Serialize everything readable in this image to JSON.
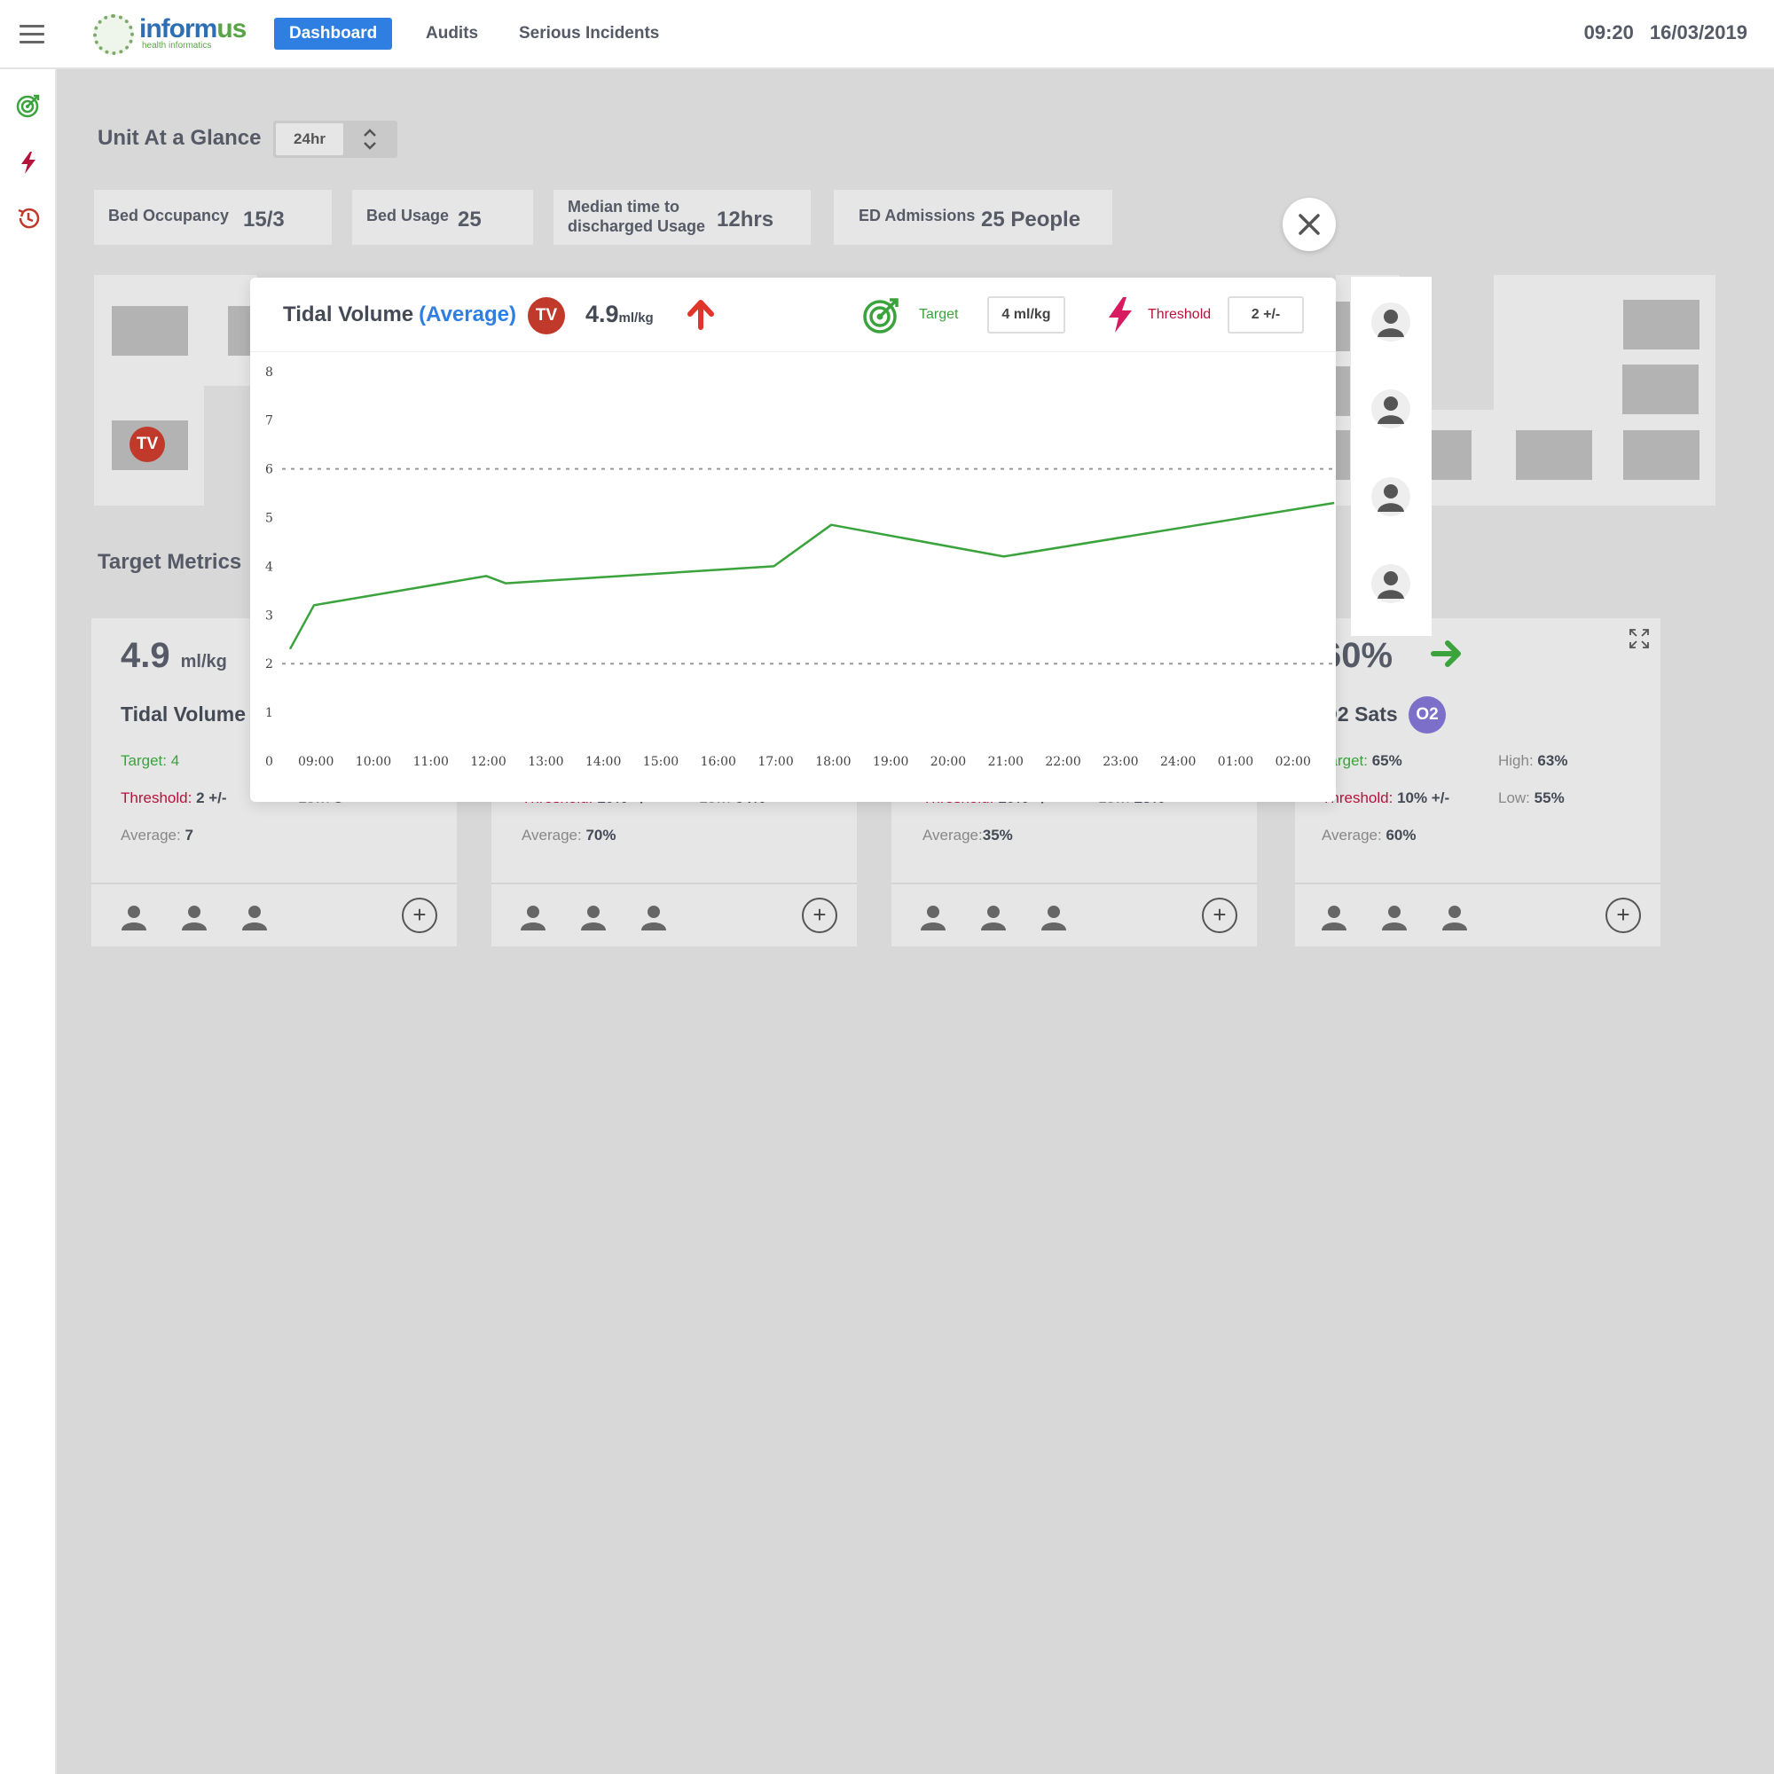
{
  "header": {
    "logo": {
      "brand_a": "inform",
      "brand_b": "us",
      "tagline": "health informatics"
    },
    "nav": [
      {
        "label": "Dashboard",
        "active": true
      },
      {
        "label": "Audits",
        "active": false
      },
      {
        "label": "Serious Incidents",
        "active": false
      }
    ],
    "time": "09:20",
    "date": "16/03/2019"
  },
  "sidebar": {
    "icons": [
      "target-icon",
      "bolt-icon",
      "history-icon"
    ]
  },
  "glance": {
    "title": "Unit At a Glance",
    "period": "24hr",
    "stats": [
      {
        "label": "Bed Occupancy",
        "value": "15/3"
      },
      {
        "label": "Bed Usage",
        "value": "25"
      },
      {
        "label_line1": "Median time to",
        "label_line2": "discharged Usage",
        "value": "12hrs"
      },
      {
        "label": "ED Admissions",
        "value": "25 People"
      }
    ]
  },
  "map": {
    "chip": "TV"
  },
  "target_metrics": {
    "title": "Target Metrics",
    "cards": [
      {
        "value": "4.9",
        "unit": "ml/kg",
        "name": "Tidal Volume",
        "target_label": "Target:",
        "target": "4",
        "threshold_label": "Threshold:",
        "threshold": "2 +/-",
        "low_label": "Low:",
        "low": "3",
        "average_label": "Average:",
        "average": "7"
      },
      {
        "threshold_label": "Threshold:",
        "threshold": "10% +/-",
        "low_label": "Low:",
        "low": "64%",
        "average_label": "Average:",
        "average": "70%"
      },
      {
        "threshold_label": "Threshold:",
        "threshold": "10% +/-",
        "low_label": "Low:",
        "low": "25%",
        "average_label": "Average:",
        "average": "35%"
      },
      {
        "value": "60%",
        "name": "O2 Sats",
        "chip": "O2",
        "target_label": "Target:",
        "target": "65%",
        "high_label": "High:",
        "high": "63%",
        "threshold_label": "Threshold:",
        "threshold": "10% +/-",
        "low_label": "Low:",
        "low": "55%",
        "average_label": "Average:",
        "average": "60%"
      }
    ],
    "add_label": "+"
  },
  "modal": {
    "title": "Tidal Volume",
    "subtitle": "(Average)",
    "chip": "TV",
    "value": "4.9",
    "unit": "ml/kg",
    "target_label": "Target",
    "target_value": "4 ml/kg",
    "threshold_label": "Threshold",
    "threshold_value": "2 +/-"
  },
  "colors": {
    "accent": "#2f7fe3",
    "line": "#3aa33c",
    "target": "#3aa33c",
    "threshold": "#b5123c",
    "tv_chip": "#c0392b",
    "o2_chip": "#7b6fc9"
  },
  "chart_data": {
    "type": "line",
    "title": "",
    "xlabel": "",
    "ylabel": "",
    "x": [
      "09:00",
      "10:00",
      "11:00",
      "12:00",
      "13:00",
      "14:00",
      "15:00",
      "16:00",
      "17:00",
      "18:00",
      "19:00",
      "20:00",
      "21:00",
      "22:00",
      "23:00",
      "24:00",
      "01:00",
      "02:00"
    ],
    "ylim": [
      0,
      8
    ],
    "yticks": [
      0,
      1,
      2,
      3,
      4,
      5,
      6,
      7,
      8
    ],
    "series": [
      {
        "points": [
          [
            "08:35",
            2.3
          ],
          [
            "09:00",
            3.2
          ],
          [
            "12:00",
            3.8
          ],
          [
            "12:20",
            3.65
          ],
          [
            "17:00",
            4.0
          ],
          [
            "18:00",
            4.85
          ],
          [
            "21:00",
            4.2
          ],
          [
            "02:45",
            5.3
          ]
        ]
      }
    ],
    "reference_lines": [
      {
        "y": 6,
        "style": "dashed"
      },
      {
        "y": 2,
        "style": "dashed"
      }
    ],
    "grid": false
  }
}
